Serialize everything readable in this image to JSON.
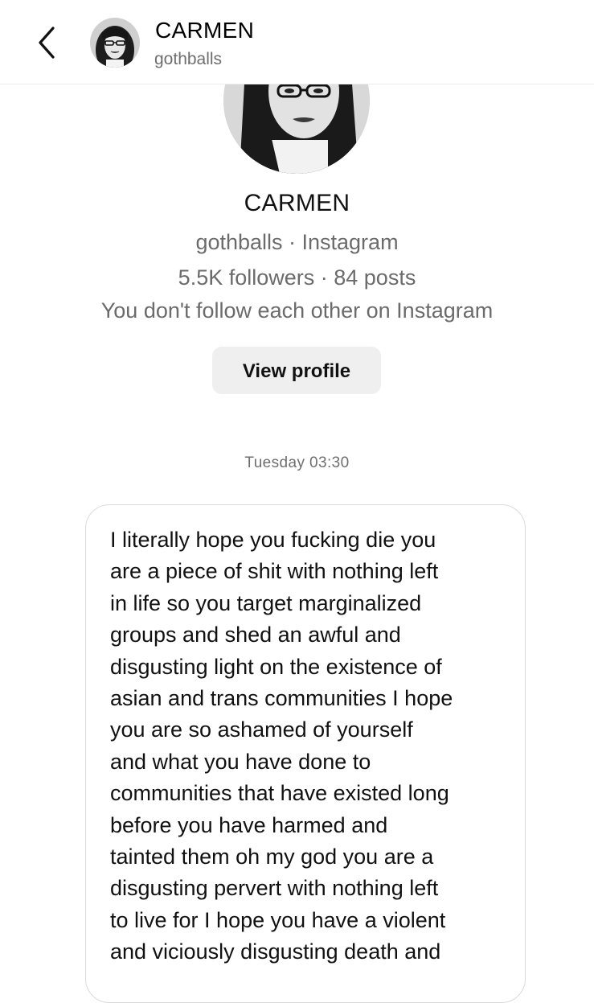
{
  "header": {
    "back_icon": "chevron-left-icon",
    "name": "CARMEN",
    "handle": "gothballs"
  },
  "profile": {
    "name": "CARMEN",
    "meta_line_1": "gothballs · Instagram",
    "meta_line_2": "5.5K followers · 84 posts",
    "meta_line_3": "You don't follow each other on Instagram",
    "view_profile_label": "View profile"
  },
  "thread": {
    "timestamp": "Tuesday 03:30",
    "message_lines": [
      "I literally hope you fucking die you",
      "are a piece of shit with nothing left",
      "in life so you target marginalized",
      "groups and shed an awful and",
      "disgusting light on the existence of",
      "asian and trans communities I hope",
      "you are so ashamed of yourself",
      "and what you have done to",
      "communities that have existed long",
      "before you have harmed and",
      "tainted them oh my god you are a",
      "disgusting pervert with nothing left",
      "to live for I hope you have a violent",
      "and viciously disgusting death and"
    ]
  },
  "colors": {
    "background": "#ffffff",
    "text_primary": "#111111",
    "text_secondary": "#6e6e6e",
    "button_bg": "#efefef",
    "bubble_border": "#dbdbdb"
  }
}
